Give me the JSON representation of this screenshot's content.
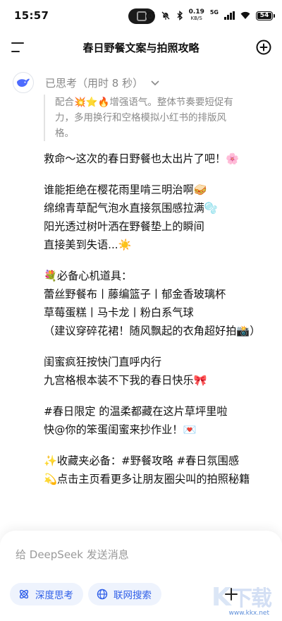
{
  "status_bar": {
    "time": "15:57",
    "net_speed": "0.19",
    "net_unit": "KB/S",
    "network": "5G",
    "battery": "54"
  },
  "header": {
    "title": "春日野餐文案与拍照攻略"
  },
  "thinking": {
    "label": "已思考（用时 8 秒）"
  },
  "thought_lines": [
    "配合💥⭐🔥增强语气。整体节奏要短促有",
    "力，多用换行和空格模拟小红书的排版风",
    "格。"
  ],
  "answer": {
    "p1": [
      "救命～这次的春日野餐也太出片了吧！🌸"
    ],
    "p2": [
      "谁能拒绝在樱花雨里啃三明治啊🥪",
      "绵绵青草配气泡水直接氛围感拉满🫧",
      "阳光透过树叶洒在野餐垫上的瞬间",
      "直接美到失语...☀️"
    ],
    "p3": [
      "💐必备心机道具：",
      "蕾丝野餐布丨藤编篮子丨郁金香玻璃杯",
      "草莓蛋糕丨马卡龙丨粉白系气球",
      "（建议穿碎花裙！随风飘起的衣角超好拍📸）"
    ],
    "p4": [
      "闺蜜疯狂按快门直呼内行",
      "九宫格根本装不下我的春日快乐🎀"
    ],
    "p5": [
      "#春日限定 的温柔都藏在这片草坪里啦",
      "快@你的笨蛋闺蜜来抄作业！💌"
    ],
    "p6": [
      "✨收藏夹必备：#野餐攻略 #春日氛围感",
      "💫点击主页看更多让朋友圈尖叫的拍照秘籍"
    ]
  },
  "composer": {
    "placeholder": "给 DeepSeek 发送消息",
    "deep_think": "深度思考",
    "web_search": "联网搜索"
  },
  "watermark": {
    "url": "www.kkx.net"
  },
  "colors": {
    "accent": "#2f5fe8",
    "chip_bg": "#eef3fd",
    "muted_text": "#8a8a8a"
  }
}
